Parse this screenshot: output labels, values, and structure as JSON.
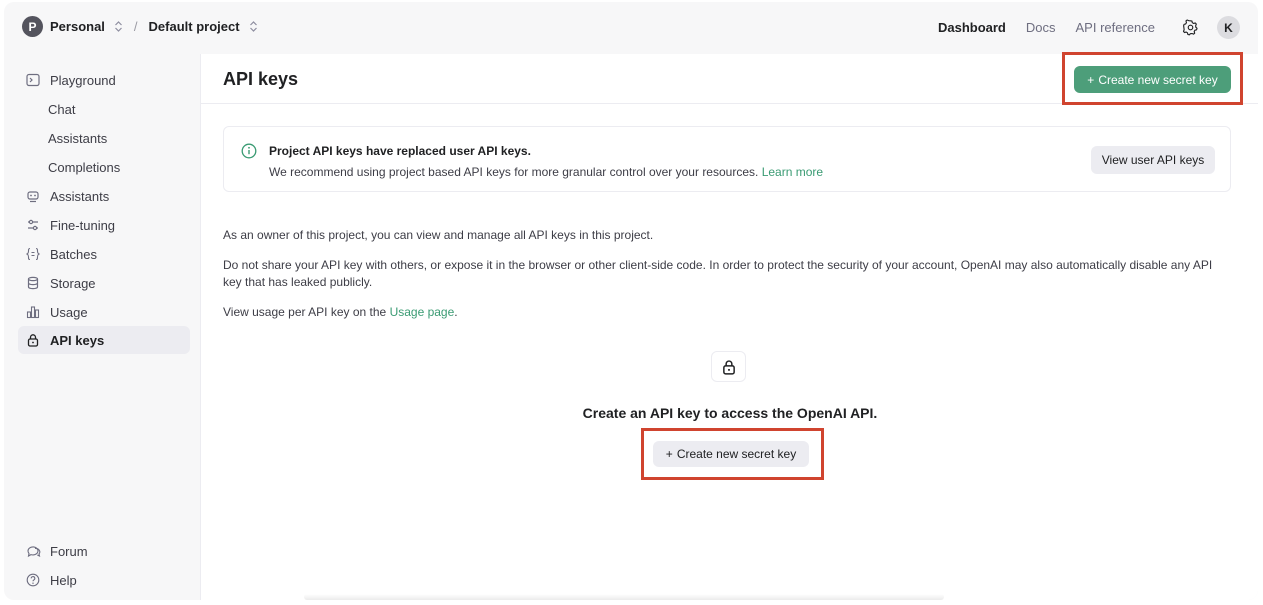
{
  "topbar": {
    "org_initial": "P",
    "org_name": "Personal",
    "project_name": "Default project",
    "separator": "/",
    "nav": [
      "Dashboard",
      "Docs",
      "API reference"
    ],
    "user_initial": "K"
  },
  "sidebar": {
    "items": [
      {
        "label": "Playground",
        "icon": "terminal-icon"
      },
      {
        "label": "Chat"
      },
      {
        "label": "Assistants"
      },
      {
        "label": "Completions"
      },
      {
        "label": "Assistants",
        "icon": "robot-icon"
      },
      {
        "label": "Fine-tuning",
        "icon": "sliders-icon"
      },
      {
        "label": "Batches",
        "icon": "braces-icon"
      },
      {
        "label": "Storage",
        "icon": "database-icon"
      },
      {
        "label": "Usage",
        "icon": "bar-chart-icon"
      },
      {
        "label": "API keys",
        "icon": "lock-icon"
      }
    ],
    "bottom": [
      {
        "label": "Forum",
        "icon": "chat-bubbles-icon"
      },
      {
        "label": "Help",
        "icon": "help-circle-icon"
      }
    ]
  },
  "main": {
    "title": "API keys",
    "create_button": "Create new secret key",
    "notice": {
      "title": "Project API keys have replaced user API keys.",
      "body": "We recommend using project based API keys for more granular control over your resources.",
      "link": "Learn more",
      "button": "View user API keys"
    },
    "para1": "As an owner of this project, you can view and manage all API keys in this project.",
    "para2": "Do not share your API key with others, or expose it in the browser or other client-side code. In order to protect the security of your account, OpenAI may also automatically disable any API key that has leaked publicly.",
    "para3_prefix": "View usage per API key on the",
    "para3_link": "Usage page",
    "para3_suffix": ".",
    "empty_text": "Create an API key to access the OpenAI API.",
    "empty_button": "Create new secret key"
  },
  "colors": {
    "accent_green": "#4d9e7a",
    "highlight_red": "#d0442f"
  }
}
